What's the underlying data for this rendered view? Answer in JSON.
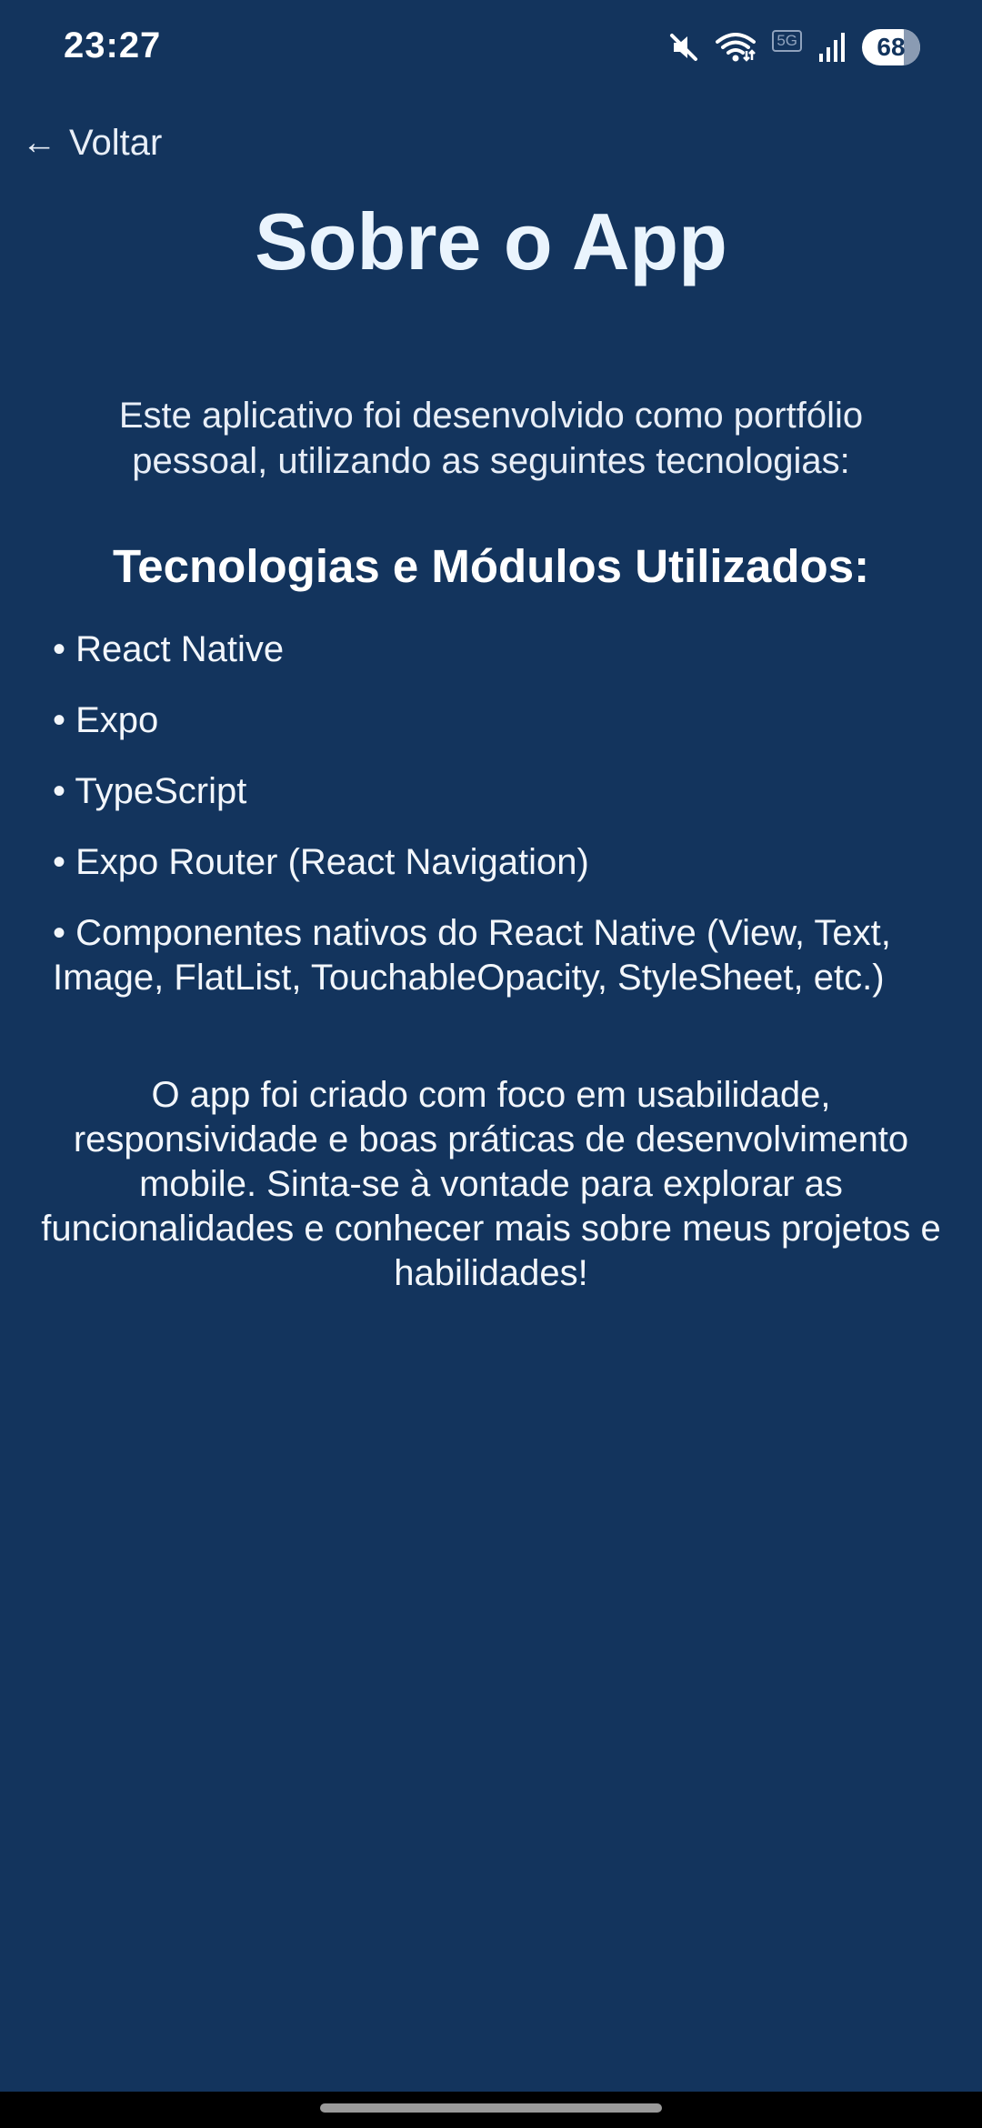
{
  "status_bar": {
    "time": "23:27",
    "network_label": "5G",
    "battery_level": "68",
    "icons": [
      "mute-icon",
      "wifi-icon",
      "signal-icon",
      "battery-icon"
    ]
  },
  "nav": {
    "back_arrow": "←",
    "back_label": "Voltar"
  },
  "page": {
    "title": "Sobre o App",
    "intro": "Este aplicativo foi desenvolvido como portfólio pessoal, utilizando as seguintes tecnologias:",
    "section_title": "Tecnologias e Módulos Utilizados:",
    "technologies": [
      "• React Native",
      "• Expo",
      "• TypeScript",
      "• Expo Router (React Navigation)",
      "• Componentes nativos do React Native (View, Text, Image, FlatList, TouchableOpacity, StyleSheet, etc.)"
    ],
    "outro": "O app foi criado com foco em usabilidade, responsividade e boas práticas de desenvolvimento mobile. Sinta-se à vontade para explorar as funcionalidades e conhecer mais sobre meus projetos e habilidades!"
  },
  "colors": {
    "background": "#13345d",
    "title": "#eaf4fd",
    "text": "#f2f6fb"
  }
}
